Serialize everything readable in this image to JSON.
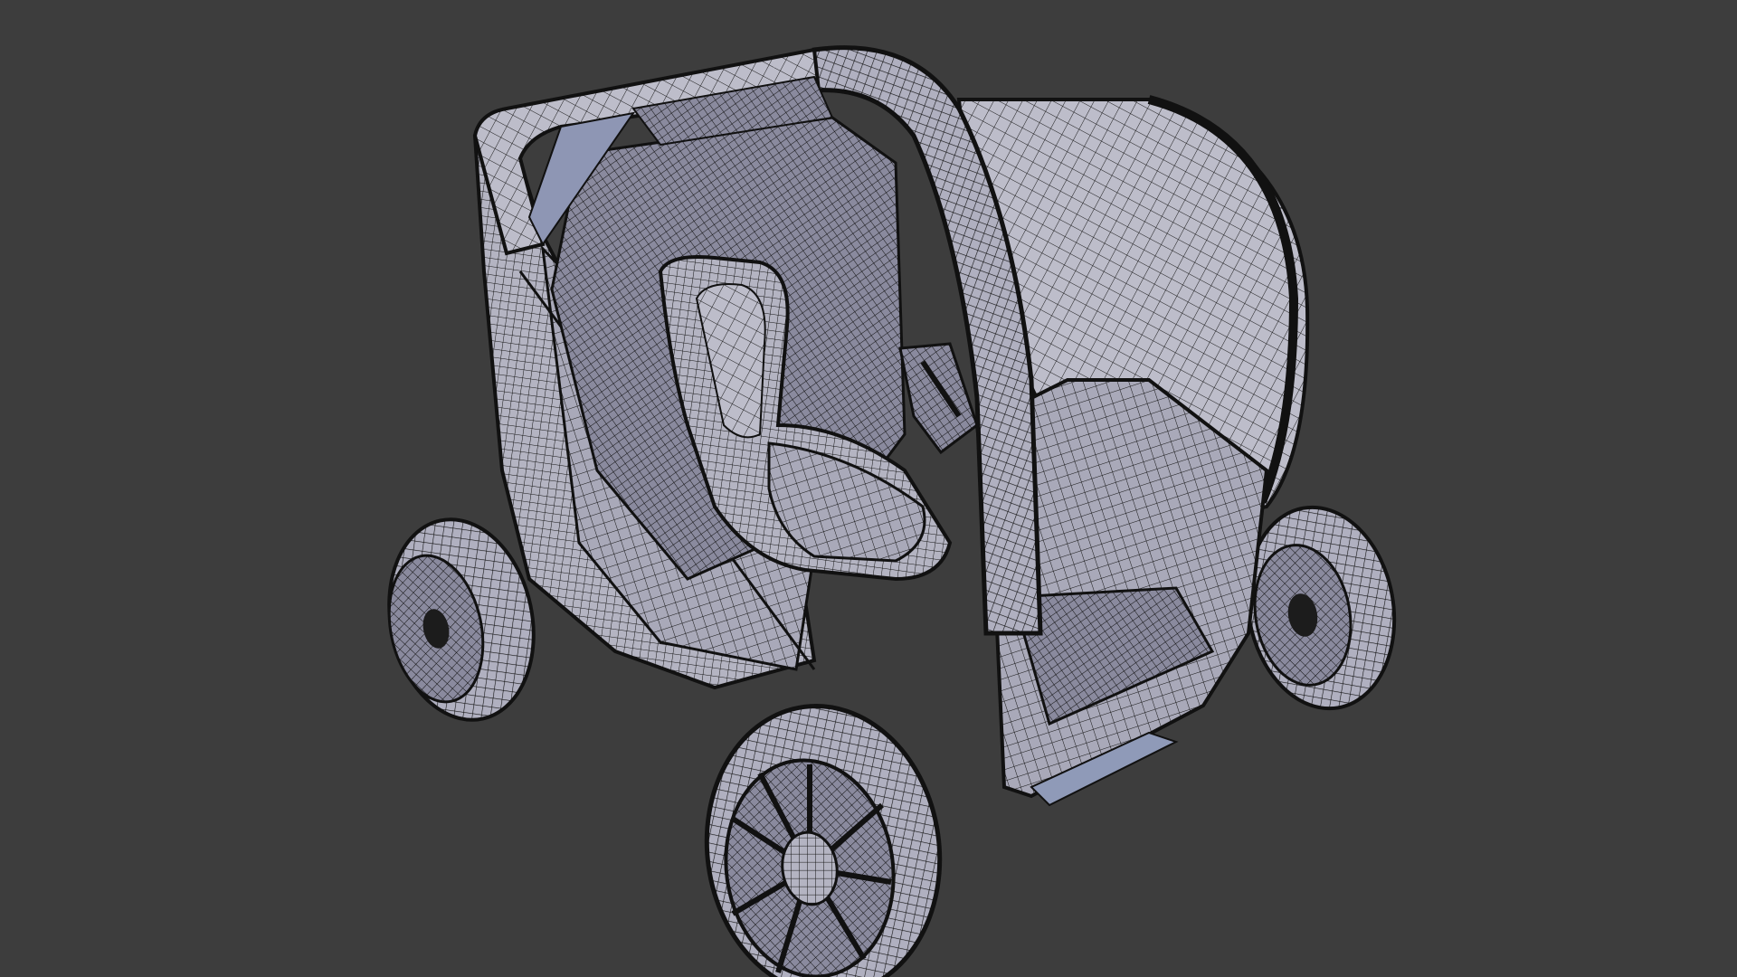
{
  "viewport": {
    "background_color": "#3d3d3d",
    "mesh_fill_color": "#b4b4c2",
    "mesh_shadow_color": "#8a8a9e",
    "wire_color": "#141414",
    "highlight_color": "#c9c9d8"
  },
  "scene": {
    "object": "wireframe-vehicle-model"
  }
}
